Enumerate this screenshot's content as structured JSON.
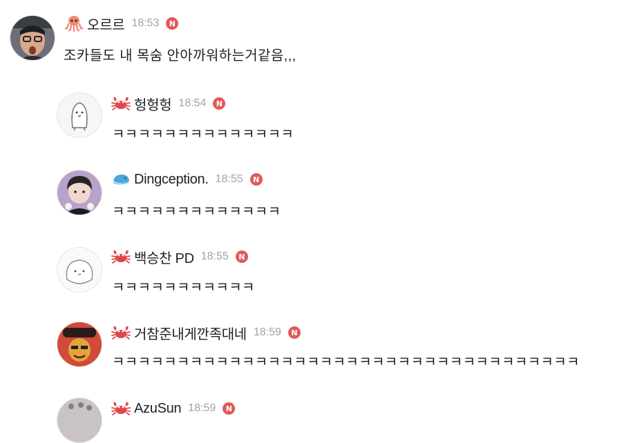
{
  "comments": [
    {
      "nickname": "오르르",
      "time": "18:53",
      "badge_icon": "octopus-icon",
      "new_badge": "N",
      "text": "조카들도 내 목숨 안아까워하는거같음,,,"
    },
    {
      "nickname": "헝헝헝",
      "time": "18:54",
      "badge_icon": "crab-icon",
      "new_badge": "N",
      "text": "ㅋㅋㅋㅋㅋㅋㅋㅋㅋㅋㅋㅋㅋㅋ"
    },
    {
      "nickname": "Dingception.",
      "time": "18:55",
      "badge_icon": "whale-icon",
      "new_badge": "N",
      "text": "ㅋㅋㅋㅋㅋㅋㅋㅋㅋㅋㅋㅋㅋ"
    },
    {
      "nickname": "백승찬 PD",
      "time": "18:55",
      "badge_icon": "crab-icon",
      "new_badge": "N",
      "text": "ㅋㅋㅋㅋㅋㅋㅋㅋㅋㅋㅋ"
    },
    {
      "nickname": "거참준내게깐족대네",
      "time": "18:59",
      "badge_icon": "crab-icon",
      "new_badge": "N",
      "text": "ㅋㅋㅋㅋㅋㅋㅋㅋㅋㅋㅋㅋㅋㅋㅋㅋㅋㅋㅋㅋㅋㅋㅋㅋㅋㅋㅋㅋㅋㅋㅋㅋㅋㅋㅋㅋ"
    },
    {
      "nickname": "AzuSun",
      "time": "18:59",
      "badge_icon": "crab-icon",
      "new_badge": "N",
      "text": ""
    }
  ],
  "colors": {
    "new_badge": "#e15a5a",
    "timestamp": "#a2a2a2",
    "crab": "#e04848",
    "octopus": "#f08a72",
    "whale": "#4aa8d8"
  }
}
